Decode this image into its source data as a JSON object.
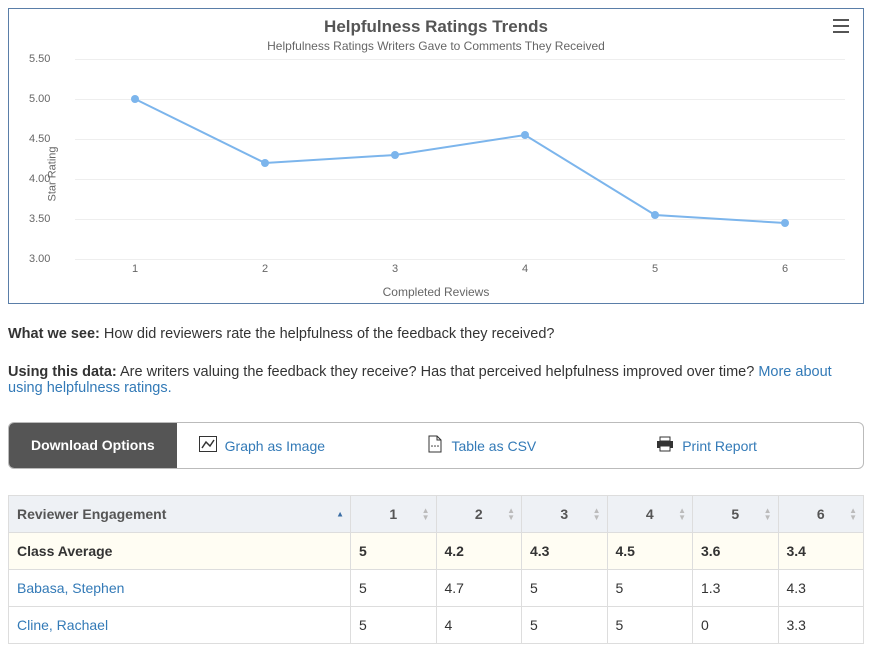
{
  "chart_data": {
    "type": "line",
    "title": "Helpfulness Ratings Trends",
    "subtitle": "Helpfulness Ratings Writers Gave to Comments They Received",
    "xlabel": "Completed Reviews",
    "ylabel": "Star Rating",
    "x": [
      1,
      2,
      3,
      4,
      5,
      6
    ],
    "values": [
      5.0,
      4.2,
      4.3,
      4.55,
      3.55,
      3.45
    ],
    "ylim": [
      3.0,
      5.5
    ],
    "yticks": [
      3.0,
      3.5,
      4.0,
      4.5,
      5.0,
      5.5
    ],
    "ytick_labels": [
      "3.00",
      "3.50",
      "4.00",
      "4.50",
      "5.00",
      "5.50"
    ]
  },
  "descriptions": {
    "what_label": "What we see:",
    "what_text": " How did reviewers rate the helpfulness of the feedback they received?",
    "using_label": "Using this data:",
    "using_text": " Are writers valuing the feedback they receive? Has that perceived helpfulness improved over time? ",
    "using_link": "More about using helpfulness ratings."
  },
  "toolbar": {
    "download": "Download Options",
    "graph": "Graph as Image",
    "csv": "Table as CSV",
    "print": "Print Report"
  },
  "table": {
    "header_first": "Reviewer Engagement",
    "columns": [
      "1",
      "2",
      "3",
      "4",
      "5",
      "6"
    ],
    "rows": [
      {
        "name": "Class Average",
        "avg": true,
        "cells": [
          "5",
          "4.2",
          "4.3",
          "4.5",
          "3.6",
          "3.4"
        ]
      },
      {
        "name": "Babasa, Stephen",
        "avg": false,
        "cells": [
          "5",
          "4.7",
          "5",
          "5",
          "1.3",
          "4.3"
        ]
      },
      {
        "name": "Cline, Rachael",
        "avg": false,
        "cells": [
          "5",
          "4",
          "5",
          "5",
          "0",
          "3.3"
        ]
      }
    ]
  }
}
